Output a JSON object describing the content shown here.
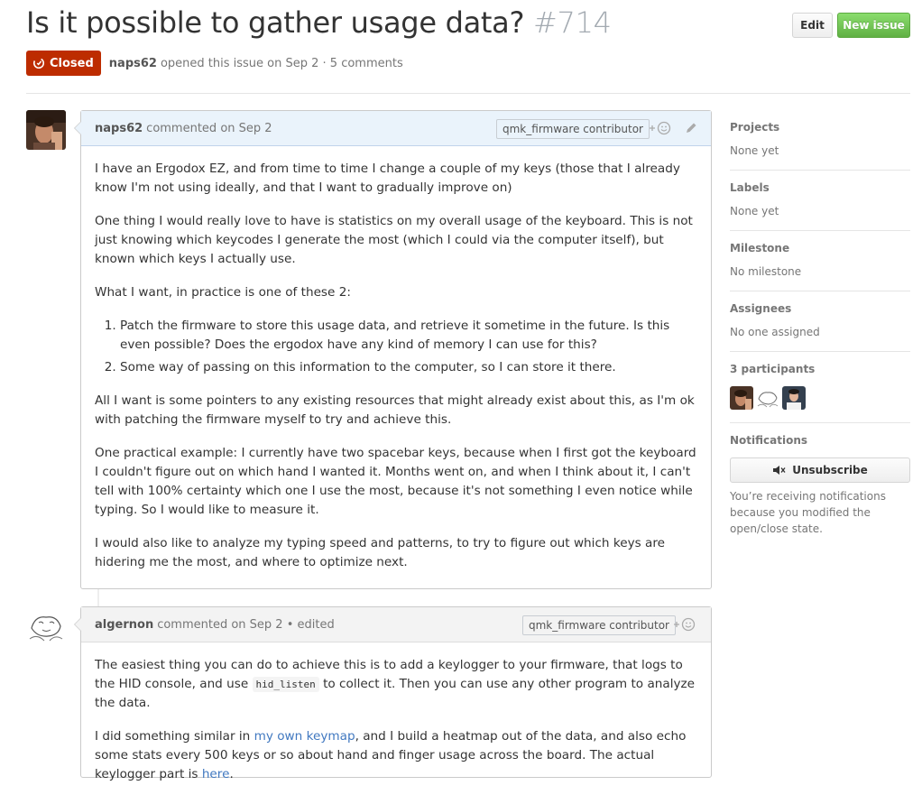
{
  "issue": {
    "title": "Is it possible to gather usage data?",
    "number": "#714",
    "state": "Closed",
    "author": "naps62",
    "meta": "opened this issue on Sep 2 · 5 comments"
  },
  "header_buttons": {
    "edit": "Edit",
    "new_issue": "New issue"
  },
  "comments": [
    {
      "author": "naps62",
      "when": "commented on Sep 2",
      "badge": "qmk_firmware contributor",
      "paragraphs": [
        "I have an Ergodox EZ, and from time to time I change a couple of my keys (those that I already know I'm not using ideally, and that I want to gradually improve on)",
        "One thing I would really love to have is statistics on my overall usage of the keyboard. This is not just knowing which keycodes I generate the most (which I could via the computer itself), but known which keys I actually use.",
        "What I want, in practice is one of these 2:",
        "All I want is some pointers to any existing resources that might already exist about this, as I'm ok with patching the firmware myself to try and achieve this.",
        "One practical example: I currently have two spacebar keys, because when I first got the keyboard I couldn't figure out on which hand I wanted it. Months went on, and when I think about it, I can't tell with 100% certainty which one I use the most, because it's not something I even notice while typing. So I would like to measure it.",
        "I would also like to analyze my typing speed and patterns, to try to figure out which keys are hidering me the most, and where to optimize next."
      ],
      "list": [
        "Patch the firmware to store this usage data, and retrieve it sometime in the future. Is this even possible? Does the ergodox have any kind of memory I can use for this?",
        "Some way of passing on this information to the computer, so I can store it there."
      ]
    },
    {
      "author": "algernon",
      "when": "commented on Sep 2 • edited",
      "badge": "qmk_firmware contributor",
      "p1_a": "The easiest thing you can do to achieve this is to add a keylogger to your firmware, that logs to the HID console, and use",
      "p1_code": "hid_listen",
      "p1_b": "to collect it. Then you can use any other program to analyze the data.",
      "p2_a": "I did something similar in",
      "p2_link1": "my own keymap",
      "p2_b": ", and I build a heatmap out of the data, and also echo some stats every 500 keys or so about hand and finger usage across the board. The actual keylogger part is",
      "p2_link2": "here",
      "p2_c": "."
    }
  ],
  "sidebar": {
    "projects_title": "Projects",
    "projects_value": "None yet",
    "labels_title": "Labels",
    "labels_value": "None yet",
    "milestone_title": "Milestone",
    "milestone_value": "No milestone",
    "assignees_title": "Assignees",
    "assignees_value": "No one assigned",
    "participants_title": "3 participants",
    "notifications_title": "Notifications",
    "unsubscribe_label": "Unsubscribe",
    "notifications_reason": "You’re receiving notifications because you modified the open/close state."
  },
  "colors": {
    "closed_badge": "#bd2c00",
    "new_issue_green": "#6cc644",
    "link": "#4078c0",
    "owner_header": "#eaf3fb"
  },
  "icons": {
    "state": "issue-closed-icon",
    "reaction": "smiley-plus-icon",
    "edit": "pencil-icon",
    "unsubscribe": "mute-icon"
  }
}
